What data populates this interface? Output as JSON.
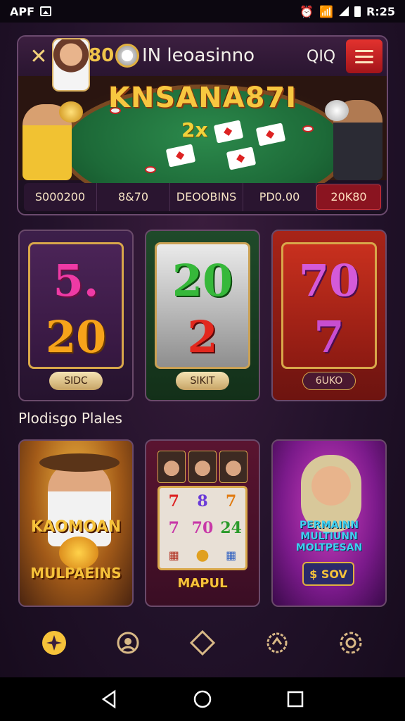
{
  "status_bar": {
    "left_text": "APF",
    "time": "R:25",
    "icons": [
      "image-icon",
      "alarm-icon",
      "wifi-icon",
      "signal-icon",
      "battery-icon"
    ]
  },
  "header": {
    "coin_value": "80",
    "title": "IN leoasinno",
    "code_label": "QIQ",
    "scene_title": "KNSANA87I",
    "multiplier": "2x"
  },
  "stats": [
    "S000200",
    "8&70",
    "DEOOBINS",
    "PD0.00",
    "20K80"
  ],
  "slots": [
    {
      "num1": "5.",
      "num2": "20",
      "pill": "SIDC"
    },
    {
      "num1": "20",
      "num2": "2",
      "pill": "SIKIT"
    },
    {
      "num1": "70",
      "num2": "7",
      "pill": "6UKO"
    }
  ],
  "section_title": "Plodisgo Plales",
  "games": [
    {
      "line1": "KAOMOAN",
      "line2": "MULPAEINS"
    },
    {
      "line1": "MAPUL",
      "reels": [
        "7",
        "8",
        "7",
        "7",
        "70",
        "24",
        "",
        "",
        ""
      ]
    },
    {
      "line1": "PERMAINN MULTIUNN MOLTPESAN",
      "badge": "$ SOV"
    }
  ],
  "colors": {
    "accent_gold": "#f6c23a",
    "menu_red": "#e3322e",
    "background": "#22122a"
  },
  "tabs": [
    "home-star-icon",
    "support-icon",
    "diamond-icon",
    "rewards-icon",
    "settings-icon"
  ],
  "nav": [
    "back-icon",
    "home-icon",
    "recents-icon"
  ]
}
